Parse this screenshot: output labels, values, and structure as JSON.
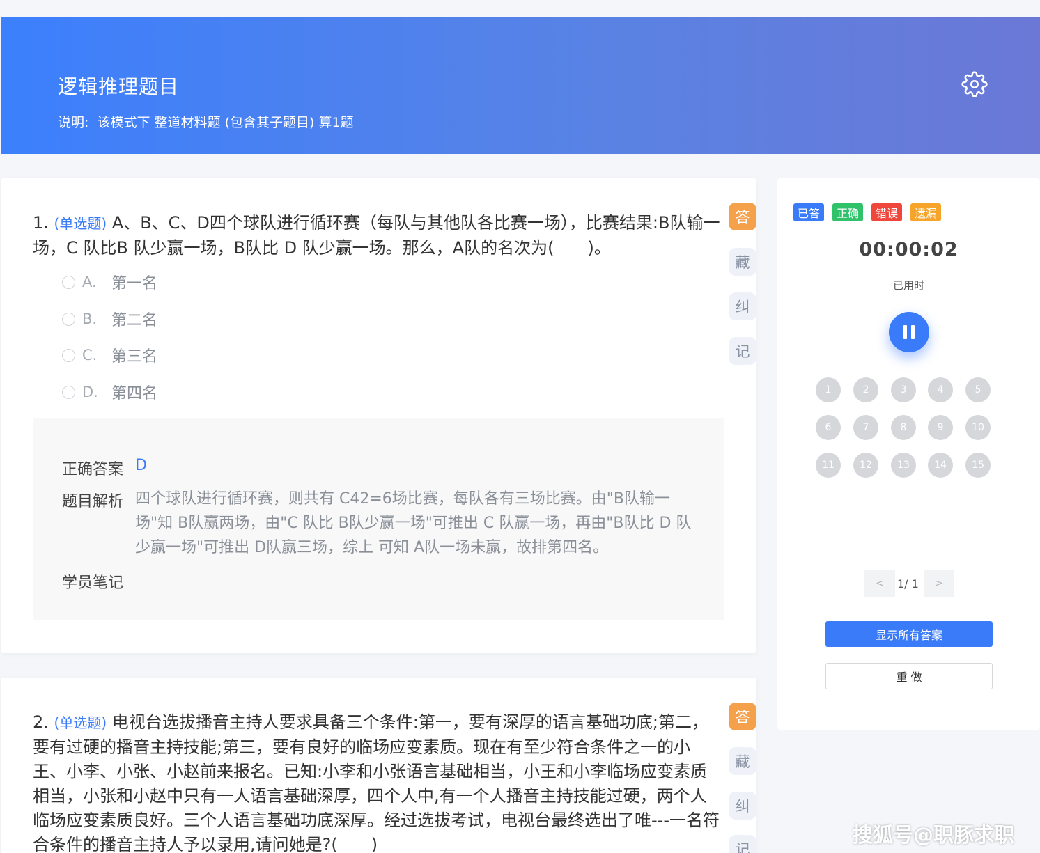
{
  "header": {
    "title": "逻辑推理题目",
    "desc_label": "说明:",
    "desc_text": "该模式下 整道材料题 (包含其子题目) 算1题"
  },
  "side_buttons": [
    "答",
    "藏",
    "纠",
    "记"
  ],
  "question1": {
    "number": "1.",
    "type": "(单选题)",
    "text": "A、B、C、D四个球队进行循环赛（每队与其他队各比赛一场），比赛结果:B队输一场，C 队比B 队少赢一场，B队比 D 队少赢一场。那么，A队的名次为(　　)。",
    "options": [
      {
        "letter": "A.",
        "text": "第一名"
      },
      {
        "letter": "B.",
        "text": "第二名"
      },
      {
        "letter": "C.",
        "text": "第三名"
      },
      {
        "letter": "D.",
        "text": "第四名"
      }
    ],
    "answer_label": "正确答案",
    "answer_value": "D",
    "analysis_label": "题目解析",
    "analysis_text": "四个球队进行循环赛，则共有 C42=6场比赛，每队各有三场比赛。由\"B队输一场\"知 B队赢两场，由\"C 队比 B队少赢一场\"可推出 C 队赢一场，再由\"B队比 D 队少赢一场\"可推出 D队赢三场，综上 可知 A队一场未赢，故排第四名。",
    "notes_label": "学员笔记"
  },
  "question2": {
    "number": "2.",
    "type": "(单选题)",
    "text": "电视台选拔播音主持人要求具备三个条件:第一，要有深厚的语言基础功底;第二，要有过硬的播音主持技能;第三，要有良好的临场应变素质。现在有至少符合条件之一的小王、小李、小张、小赵前来报名。已知:小李和小张语言基础相当，小王和小李临场应变素质相当，小张和小赵中只有一人语言基础深厚，四个人中,有一个人播音主持技能过硬，两个人临场应变素质良好。三个人语言基础功底深厚。经过选拔考试，电视台最终选出了唯---一名符合条件的播音主持人予以录用,请问她是?(　　)"
  },
  "panel": {
    "legend": [
      {
        "label": "已答",
        "color": "#3a7bfa"
      },
      {
        "label": "正确",
        "color": "#2fc26b"
      },
      {
        "label": "错误",
        "color": "#f0473d"
      },
      {
        "label": "遗漏",
        "color": "#f6a52a"
      }
    ],
    "timer": "00:00:02",
    "timer_label": "已用时",
    "numbers": [
      "1",
      "2",
      "3",
      "4",
      "5",
      "6",
      "7",
      "8",
      "9",
      "10",
      "11",
      "12",
      "13",
      "14",
      "15"
    ],
    "pager_prev": "<",
    "pager_text": "1/ 1",
    "pager_next": ">",
    "show_answers": "显示所有答案",
    "redo": "重 做"
  },
  "watermark": "搜狐号@职豚求职"
}
